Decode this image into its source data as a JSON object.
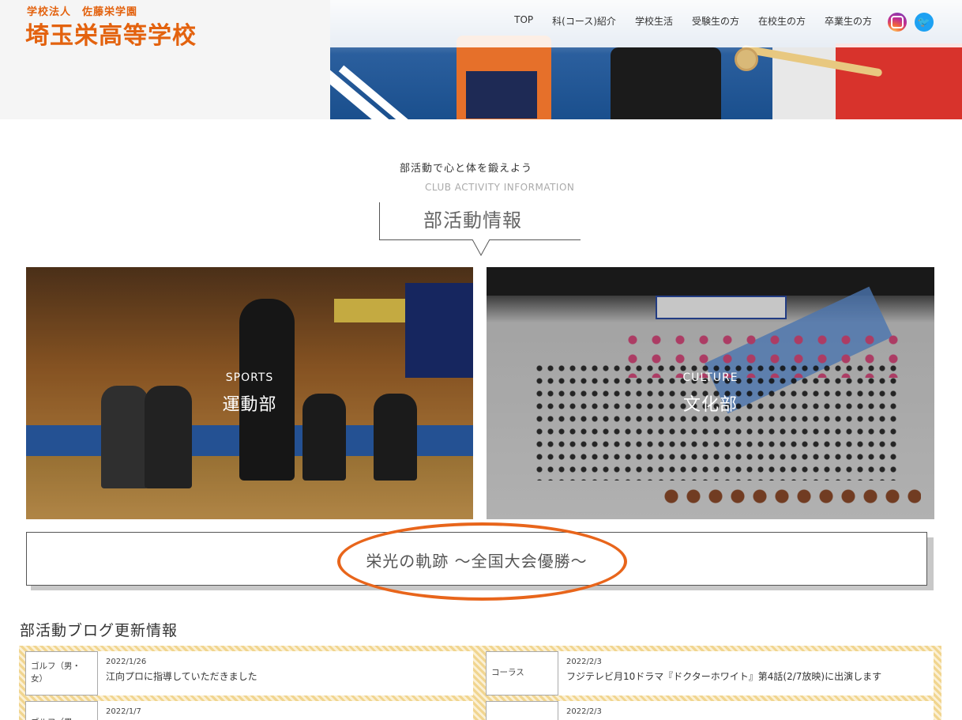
{
  "header": {
    "logo_sub": "学校法人　佐藤栄学園",
    "logo_main": "埼玉栄高等学校",
    "nav": [
      "TOP",
      "科(コース)紹介",
      "学校生活",
      "受験生の方",
      "在校生の方",
      "卒業生の方"
    ],
    "social": [
      {
        "icon": "instagram-icon",
        "label": ""
      },
      {
        "icon": "twitter-icon",
        "label": ""
      }
    ]
  },
  "section": {
    "tagline": "部活動で心と体を鍛えよう",
    "en_title": "CLUB ACTIVITY INFORMATION",
    "title": "部活動情報"
  },
  "cards": {
    "sports": {
      "en": "SPORTS",
      "jp": "運動部"
    },
    "culture": {
      "en": "CULTURE",
      "jp": "文化部"
    }
  },
  "glory": {
    "label": "栄光の軌跡 〜全国大会優勝〜",
    "highlight_color": "#e8651b"
  },
  "blog": {
    "title": "部活動ブログ更新情報",
    "items": [
      {
        "category": "ゴルフ（男・女）",
        "date": "2022/1/26",
        "headline": "江向プロに指導していただきました"
      },
      {
        "category": "コーラス",
        "date": "2022/2/3",
        "headline": "フジテレビ月10ドラマ『ドクターホワイト』第4話(2/7放映)に出演します"
      },
      {
        "category": "ゴルフ（男・",
        "date": "2022/1/7",
        "headline": ""
      },
      {
        "category": "",
        "date": "2022/2/3",
        "headline": ""
      }
    ]
  },
  "colors": {
    "brand": "#e3620e",
    "twitter": "#1da1f2"
  }
}
